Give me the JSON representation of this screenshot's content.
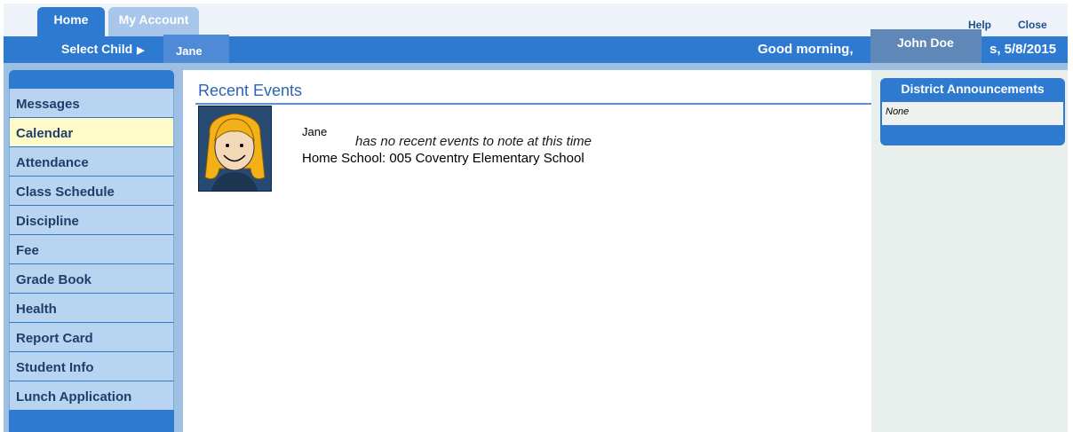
{
  "tabs": [
    {
      "label": "Home",
      "active": true
    },
    {
      "label": "My Account",
      "active": false
    }
  ],
  "top_links": {
    "help": "Help",
    "close": "Close"
  },
  "header": {
    "select_child_label": "Select Child",
    "child_name": "Jane",
    "greeting": "Good morning,",
    "user_name": "John Doe",
    "date_text": "s, 5/8/2015"
  },
  "sidebar": {
    "items": [
      {
        "label": "Messages",
        "active": false
      },
      {
        "label": "Calendar",
        "active": true
      },
      {
        "label": "Attendance",
        "active": false
      },
      {
        "label": "Class Schedule",
        "active": false
      },
      {
        "label": "Discipline",
        "active": false
      },
      {
        "label": "Fee",
        "active": false
      },
      {
        "label": "Grade Book",
        "active": false
      },
      {
        "label": "Health",
        "active": false
      },
      {
        "label": "Report Card",
        "active": false
      },
      {
        "label": "Student Info",
        "active": false
      },
      {
        "label": "Lunch Application",
        "active": false
      }
    ]
  },
  "main": {
    "title": "Recent Events",
    "student_name": "Jane",
    "no_events_text": "has no recent events to note at this time",
    "home_school": "Home School: 005 Coventry Elementary School"
  },
  "announcements": {
    "title": "District Announcements",
    "body": "None"
  },
  "colors": {
    "header_blue": "#2d7ad0",
    "active_nav": "#fffbc9",
    "nav_bg": "#b9d4f1"
  }
}
